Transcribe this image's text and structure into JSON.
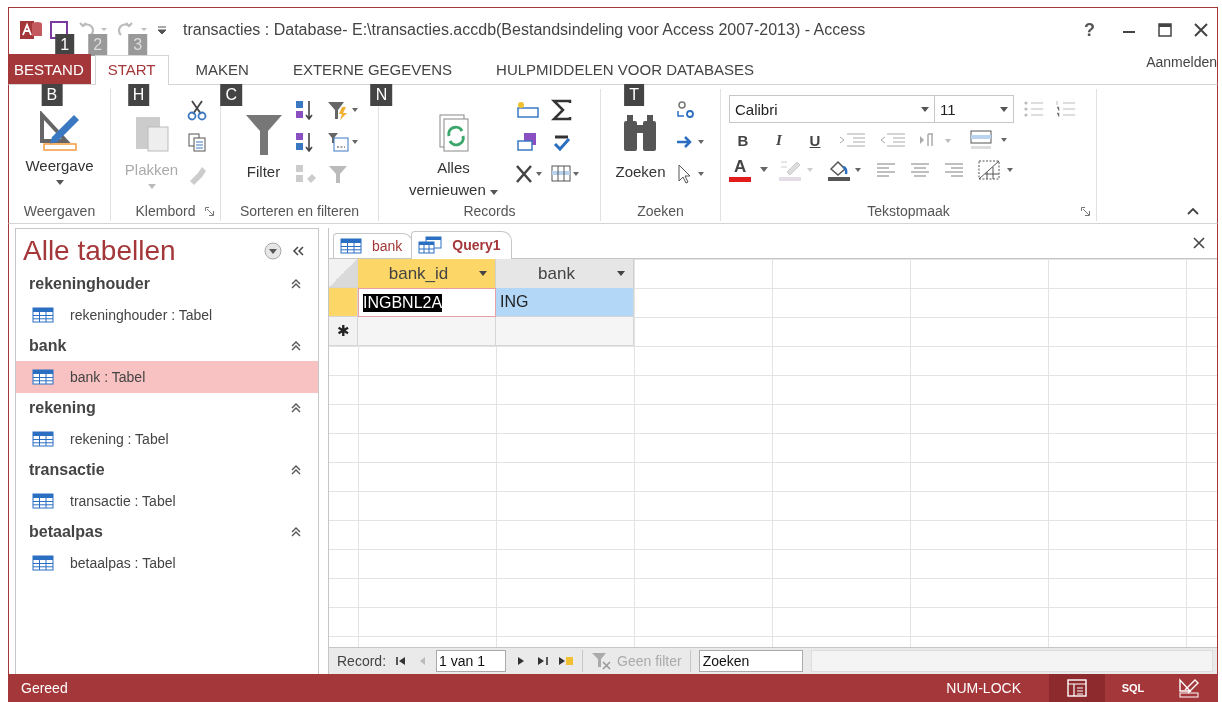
{
  "window": {
    "title": "transacties : Database- E:\\transacties.accdb(Bestandsindeling voor Access 2007-2013) - Access",
    "help": "?"
  },
  "quick_access": [
    {
      "keytip": "1",
      "disabled": false
    },
    {
      "keytip": "2",
      "disabled": true
    },
    {
      "keytip": "3",
      "disabled": true
    }
  ],
  "ribbon_tabs": [
    {
      "label": "BESTAND",
      "kind": "file",
      "selected": false,
      "keytip": "B"
    },
    {
      "label": "START",
      "kind": "tab",
      "selected": true,
      "keytip": "H"
    },
    {
      "label": "MAKEN",
      "kind": "tab",
      "selected": false,
      "keytip": "C"
    },
    {
      "label": "EXTERNE GEGEVENS",
      "kind": "tab",
      "selected": false,
      "keytip": "N"
    },
    {
      "label": "HULPMIDDELEN VOOR DATABASES",
      "kind": "tab",
      "selected": false,
      "keytip": "T"
    }
  ],
  "account": "Aanmelden",
  "ribbon_groups": [
    {
      "label": "Weergaven",
      "launcher": false,
      "button": {
        "label": "Weergave",
        "disabled": false
      }
    },
    {
      "label": "Klembord",
      "launcher": true,
      "button": {
        "label": "Plakken",
        "disabled": true
      }
    },
    {
      "label": "Sorteren en filteren",
      "launcher": false,
      "button": {
        "label": "Filter",
        "disabled": false
      }
    },
    {
      "label": "Records",
      "launcher": false,
      "button": {
        "label": "Alles vernieuwen",
        "disabled": false
      }
    },
    {
      "label": "Zoeken",
      "launcher": false,
      "button": {
        "label": "Zoeken",
        "disabled": false
      }
    },
    {
      "label": "Tekstopmaak",
      "launcher": true,
      "font": "Calibri",
      "size": "11",
      "format_buttons": [
        "B",
        "I",
        "U"
      ],
      "font_color": "A"
    }
  ],
  "nav_pane": {
    "title": "Alle tabellen",
    "groups": [
      {
        "name": "rekeninghouder",
        "items": [
          {
            "label": "rekeninghouder : Tabel",
            "selected": false
          }
        ]
      },
      {
        "name": "bank",
        "items": [
          {
            "label": "bank : Tabel",
            "selected": true
          }
        ]
      },
      {
        "name": "rekening",
        "items": [
          {
            "label": "rekening : Tabel",
            "selected": false
          }
        ]
      },
      {
        "name": "transactie",
        "items": [
          {
            "label": "transactie : Tabel",
            "selected": false
          }
        ]
      },
      {
        "name": "betaalpas",
        "items": [
          {
            "label": "betaalpas : Tabel",
            "selected": false
          }
        ]
      }
    ]
  },
  "doc_tabs": [
    {
      "label": "bank",
      "kind": "table",
      "selected": false
    },
    {
      "label": "Query1",
      "kind": "query",
      "selected": true
    }
  ],
  "datasheet": {
    "columns": [
      {
        "label": "bank_id",
        "selected": true
      },
      {
        "label": "bank",
        "selected": false
      }
    ],
    "rows": [
      {
        "cells": [
          "INGBNL2A",
          "ING"
        ],
        "selected": true
      }
    ],
    "new_row_marker": "✱"
  },
  "record_nav": {
    "label": "Record:",
    "position": "1 van 1",
    "filter": "Geen filter",
    "filter_disabled": true,
    "search": {
      "placeholder": "Zoeken"
    }
  },
  "status_bar": {
    "text": "Gereed",
    "num_lock": "NUM-LOCK",
    "views": [
      {
        "kind": "datasheet",
        "selected": true
      },
      {
        "kind": "sql",
        "label": "SQL",
        "selected": false
      },
      {
        "kind": "design",
        "selected": false
      }
    ]
  }
}
